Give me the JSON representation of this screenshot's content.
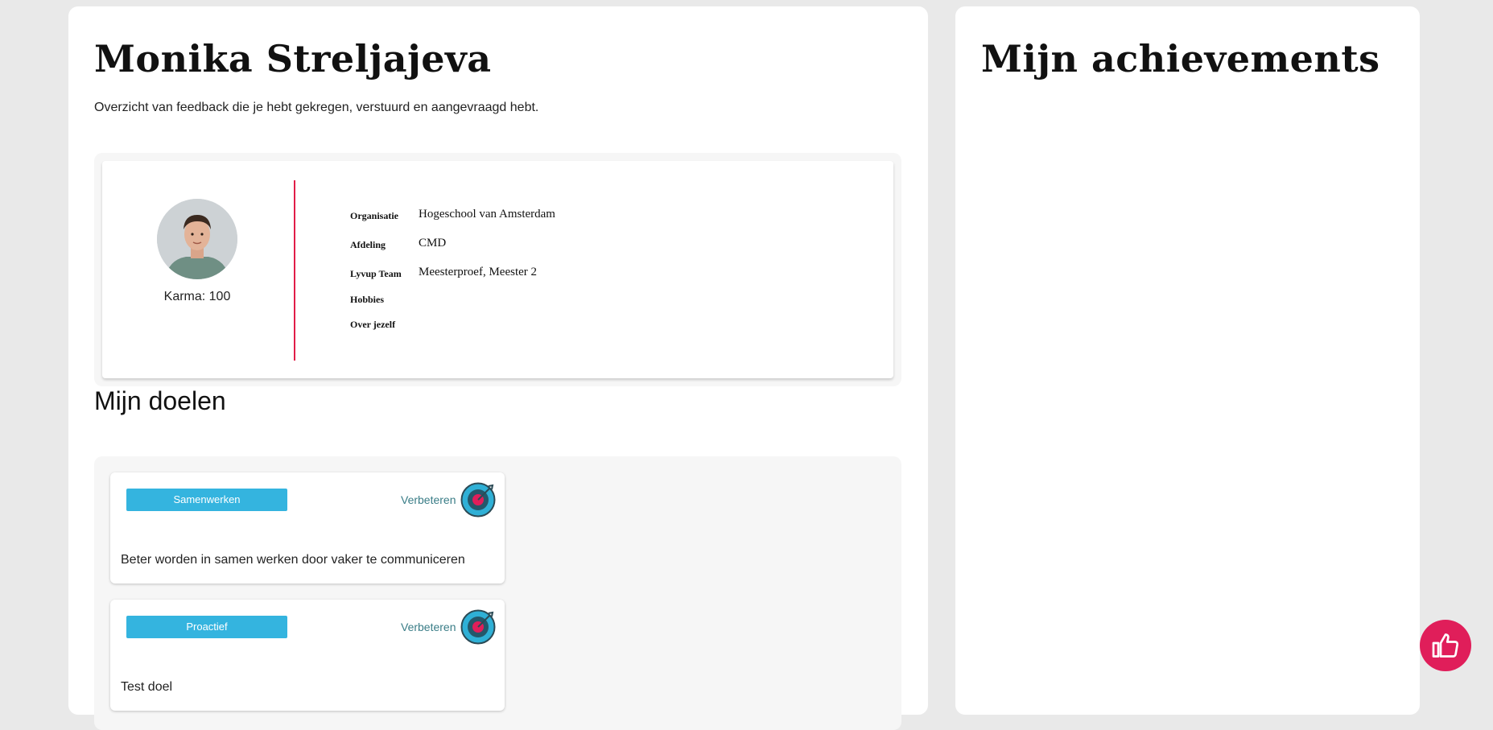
{
  "profile": {
    "name": "Monika Streljajeva",
    "subtitle": "Overzicht van feedback die je hebt gekregen, verstuurd en aangevraagd hebt.",
    "karma": "Karma: 100",
    "fields": [
      {
        "label": "Organisatie",
        "value": "Hogeschool van Amsterdam"
      },
      {
        "label": "Afdeling",
        "value": "CMD"
      },
      {
        "label": "Lyvup Team",
        "value": "Meesterproef, Meester 2"
      },
      {
        "label": "Hobbies",
        "value": ""
      },
      {
        "label": "Over jezelf",
        "value": ""
      }
    ],
    "accent_color": "#e11d48"
  },
  "goals": {
    "title": "Mijn doelen",
    "items": [
      {
        "tag": "Samenwerken",
        "status": "Verbeteren",
        "description": "Beter worden in samen werken door vaker te communiceren"
      },
      {
        "tag": "Proactief",
        "status": "Verbeteren",
        "description": "Test doel"
      }
    ],
    "tag_color": "#34b4df"
  },
  "achievements": {
    "title": "Mijn achievements"
  },
  "like_button": {
    "icon": "thumbs-up-icon",
    "color": "#e01e5a"
  }
}
